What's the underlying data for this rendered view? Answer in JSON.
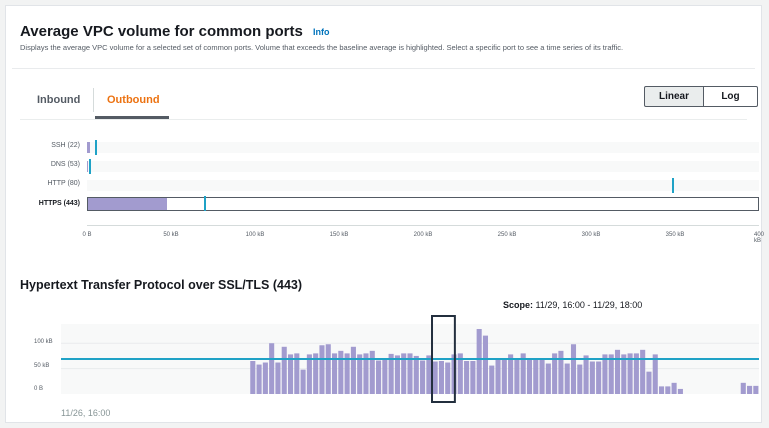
{
  "header": {
    "title": "Average VPC volume for common ports",
    "info_link": "Info",
    "description": "Displays the average VPC volume for a selected set of common ports. Volume that exceeds the baseline average is highlighted. Select a specific port to see a time series of its traffic."
  },
  "tabs": [
    {
      "label": "Inbound",
      "selected": false
    },
    {
      "label": "Outbound",
      "selected": true
    }
  ],
  "scale_toggle": {
    "linear_label": "Linear",
    "log_label": "Log",
    "selected": "Linear"
  },
  "ports_chart": {
    "axis_max_kb": 400,
    "ticks": [
      "0 B",
      "50 kB",
      "100 kB",
      "150 kB",
      "200 kB",
      "250 kB",
      "300 kB",
      "350 kB",
      "400 kB"
    ],
    "ports": [
      {
        "label": "SSH (22)",
        "value_kb": 2,
        "baseline_kb": 5,
        "selected": false
      },
      {
        "label": "DNS (53)",
        "value_kb": 0.5,
        "baseline_kb": 1,
        "selected": false
      },
      {
        "label": "HTTP (80)",
        "value_kb": 0,
        "baseline_kb": 348,
        "selected": false
      },
      {
        "label": "HTTPS (443)",
        "value_kb": 47,
        "baseline_kb": 69,
        "selected": true
      }
    ]
  },
  "timeseries": {
    "title": "Hypertext Transfer Protocol over SSL/TLS (443)",
    "scope_label": "Scope:",
    "scope_value": "11/29, 16:00 - 11/29, 18:00",
    "y_ticks": [
      "100 kB",
      "50 kB",
      "0 B"
    ],
    "x_start_label": "11/26, 16:00",
    "colors": {
      "bar": "#a29bcf",
      "baseline": "#1fa2c6",
      "scope_box": "#232f3e"
    }
  },
  "chart_data": {
    "type": "bar",
    "title": "Hypertext Transfer Protocol over SSL/TLS (443)",
    "xlabel": "",
    "ylabel": "",
    "ylim": [
      0,
      130
    ],
    "x_start": "11/26, 16:00",
    "baseline_kb": 69,
    "scope_index_range": [
      56,
      58
    ],
    "values": [
      0,
      0,
      0,
      0,
      0,
      0,
      0,
      0,
      0,
      0,
      0,
      0,
      0,
      0,
      0,
      0,
      0,
      0,
      0,
      0,
      0,
      0,
      0,
      0,
      0,
      0,
      0,
      0,
      0,
      0,
      65,
      58,
      62,
      100,
      62,
      93,
      78,
      80,
      48,
      78,
      80,
      96,
      98,
      80,
      85,
      80,
      93,
      78,
      80,
      85,
      66,
      68,
      79,
      76,
      80,
      80,
      75,
      66,
      76,
      64,
      65,
      62,
      78,
      80,
      65,
      65,
      128,
      115,
      56,
      70,
      70,
      78,
      68,
      80,
      70,
      67,
      70,
      60,
      80,
      85,
      60,
      98,
      58,
      76,
      64,
      64,
      78,
      78,
      87,
      78,
      80,
      80,
      87,
      44,
      78,
      15,
      15,
      22,
      10,
      0,
      0,
      0,
      0,
      0,
      0,
      0,
      0,
      0,
      22,
      16,
      16
    ]
  }
}
